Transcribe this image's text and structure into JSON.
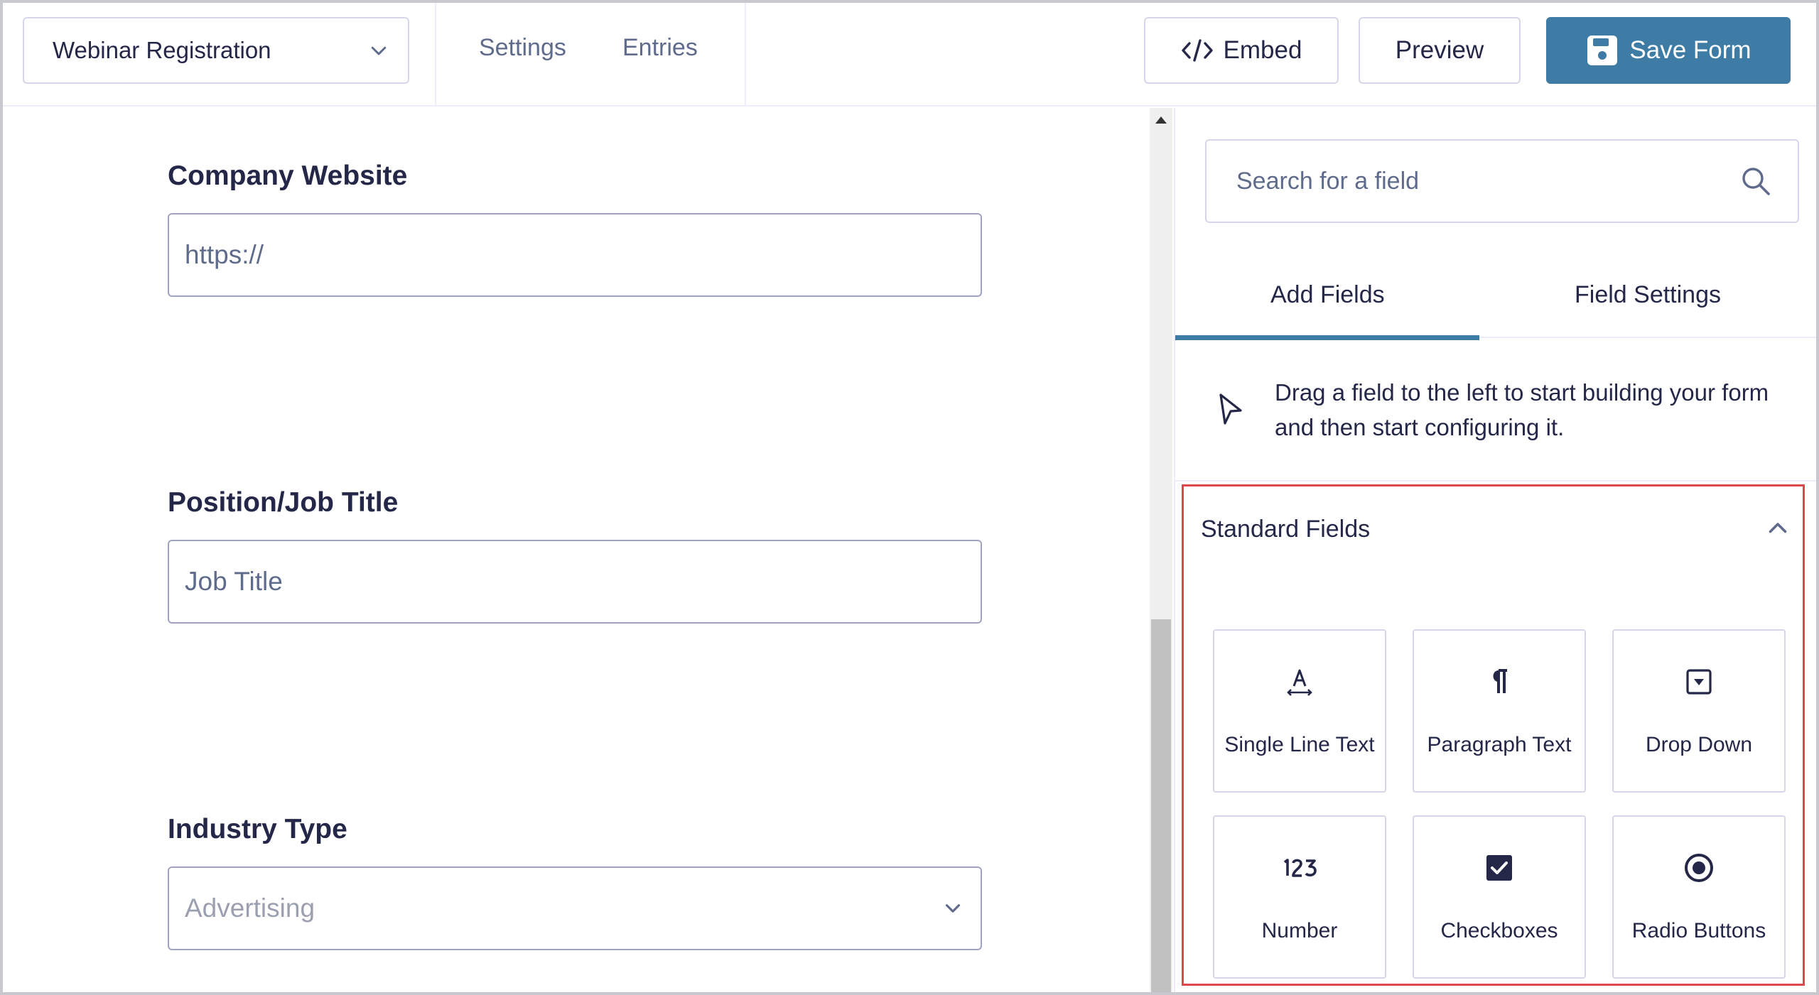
{
  "header": {
    "form_name": "Webinar Registration",
    "nav": [
      "Settings",
      "Entries"
    ],
    "embed_label": "Embed",
    "preview_label": "Preview",
    "save_label": "Save Form"
  },
  "canvas": {
    "fields": [
      {
        "label": "Company Website",
        "value": "https://",
        "type": "input"
      },
      {
        "label": "Position/Job Title",
        "value": "Job Title",
        "type": "input"
      },
      {
        "label": "Industry Type",
        "value": "Advertising",
        "type": "select"
      }
    ]
  },
  "panel": {
    "search_placeholder": "Search for a field",
    "tabs": [
      "Add Fields",
      "Field Settings"
    ],
    "active_tab": "Add Fields",
    "hint_text": "Drag a field to the left to start building your form and then start configuring it.",
    "section_title": "Standard Fields",
    "tiles": [
      {
        "label": "Single Line Text",
        "icon": "single-line-text-icon"
      },
      {
        "label": "Paragraph Text",
        "icon": "paragraph-icon"
      },
      {
        "label": "Drop Down",
        "icon": "dropdown-icon"
      },
      {
        "label": "Number",
        "icon": "number-icon"
      },
      {
        "label": "Checkboxes",
        "icon": "checkbox-icon"
      },
      {
        "label": "Radio Buttons",
        "icon": "radio-icon"
      }
    ]
  },
  "colors": {
    "accent": "#3e7ca6",
    "highlight_border": "#e0474c",
    "text": "#242748",
    "muted": "#5f6b8a"
  }
}
